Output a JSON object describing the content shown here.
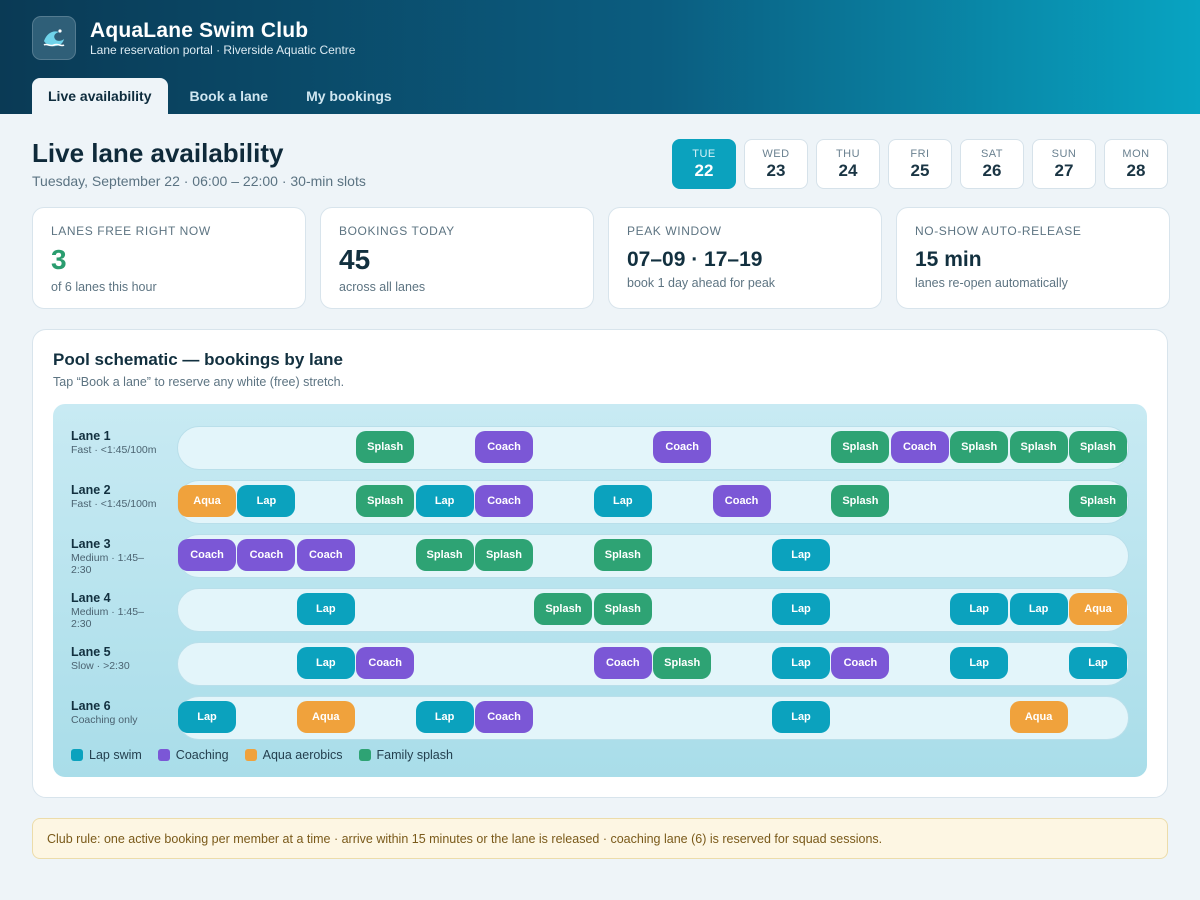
{
  "app": {
    "title": "AquaLane Swim Club",
    "subtitle": "Lane reservation portal · Riverside Aquatic Centre",
    "logo_icon": "wave-icon"
  },
  "tabs": [
    {
      "label": "Live availability",
      "active": true
    },
    {
      "label": "Book a lane",
      "active": false
    },
    {
      "label": "My bookings",
      "active": false
    }
  ],
  "page": {
    "title": "Live lane availability",
    "subtitle": "Tuesday, September 22 · 06:00 – 22:00 · 30-min slots"
  },
  "days": [
    {
      "weekday": "TUE",
      "date": "22",
      "selected": true
    },
    {
      "weekday": "WED",
      "date": "23",
      "selected": false
    },
    {
      "weekday": "THU",
      "date": "24",
      "selected": false
    },
    {
      "weekday": "FRI",
      "date": "25",
      "selected": false
    },
    {
      "weekday": "SAT",
      "date": "26",
      "selected": false
    },
    {
      "weekday": "SUN",
      "date": "27",
      "selected": false
    },
    {
      "weekday": "MON",
      "date": "28",
      "selected": false
    }
  ],
  "stats": [
    {
      "label": "LANES FREE RIGHT NOW",
      "value": "3",
      "hint": "of 6 lanes this hour",
      "accent": "#2a9d6f"
    },
    {
      "label": "BOOKINGS TODAY",
      "value": "45",
      "hint": "across all lanes"
    },
    {
      "label": "PEAK WINDOW",
      "value": "07–09 · 17–19",
      "hint": "book 1 day ahead for peak"
    },
    {
      "label": "NO-SHOW AUTO-RELEASE",
      "value": "15 min",
      "hint": "lanes re-open automatically"
    }
  ],
  "pool": {
    "title": "Pool schematic — bookings by lane",
    "subtitle": "Tap “Book a lane” to reserve any white (free) stretch.",
    "labels": {
      "lap": "Lap",
      "coach": "Coach",
      "aqua": "Aqua",
      "splash": "Splash"
    },
    "lanes": [
      {
        "name": "Lane 1",
        "desc": "Fast · <1:45/100m",
        "bookings": [
          {
            "slot": 3,
            "type": "splash"
          },
          {
            "slot": 5,
            "type": "coach"
          },
          {
            "slot": 8,
            "type": "coach"
          },
          {
            "slot": 11,
            "type": "splash"
          },
          {
            "slot": 12,
            "type": "coach"
          },
          {
            "slot": 13,
            "type": "splash"
          },
          {
            "slot": 14,
            "type": "splash"
          },
          {
            "slot": 15,
            "type": "splash"
          }
        ]
      },
      {
        "name": "Lane 2",
        "desc": "Fast · <1:45/100m",
        "bookings": [
          {
            "slot": 0,
            "type": "aqua"
          },
          {
            "slot": 1,
            "type": "lap"
          },
          {
            "slot": 3,
            "type": "splash"
          },
          {
            "slot": 4,
            "type": "lap"
          },
          {
            "slot": 5,
            "type": "coach"
          },
          {
            "slot": 7,
            "type": "lap"
          },
          {
            "slot": 9,
            "type": "coach"
          },
          {
            "slot": 11,
            "type": "splash"
          },
          {
            "slot": 15,
            "type": "splash"
          }
        ]
      },
      {
        "name": "Lane 3",
        "desc": "Medium · 1:45–2:30",
        "bookings": [
          {
            "slot": 0,
            "type": "coach"
          },
          {
            "slot": 1,
            "type": "coach"
          },
          {
            "slot": 2,
            "type": "coach"
          },
          {
            "slot": 4,
            "type": "splash"
          },
          {
            "slot": 5,
            "type": "splash"
          },
          {
            "slot": 7,
            "type": "splash"
          },
          {
            "slot": 10,
            "type": "lap"
          }
        ]
      },
      {
        "name": "Lane 4",
        "desc": "Medium · 1:45–2:30",
        "bookings": [
          {
            "slot": 2,
            "type": "lap"
          },
          {
            "slot": 6,
            "type": "splash"
          },
          {
            "slot": 7,
            "type": "splash"
          },
          {
            "slot": 10,
            "type": "lap"
          },
          {
            "slot": 13,
            "type": "lap"
          },
          {
            "slot": 14,
            "type": "lap"
          },
          {
            "slot": 15,
            "type": "aqua"
          }
        ]
      },
      {
        "name": "Lane 5",
        "desc": "Slow · >2:30",
        "bookings": [
          {
            "slot": 2,
            "type": "lap"
          },
          {
            "slot": 3,
            "type": "coach"
          },
          {
            "slot": 7,
            "type": "coach"
          },
          {
            "slot": 8,
            "type": "splash"
          },
          {
            "slot": 10,
            "type": "lap"
          },
          {
            "slot": 11,
            "type": "coach"
          },
          {
            "slot": 13,
            "type": "lap"
          },
          {
            "slot": 15,
            "type": "lap"
          }
        ]
      },
      {
        "name": "Lane 6",
        "desc": "Coaching only",
        "bookings": [
          {
            "slot": 0,
            "type": "lap"
          },
          {
            "slot": 2,
            "type": "aqua"
          },
          {
            "slot": 4,
            "type": "lap"
          },
          {
            "slot": 5,
            "type": "coach"
          },
          {
            "slot": 10,
            "type": "lap"
          },
          {
            "slot": 14,
            "type": "aqua"
          }
        ]
      }
    ],
    "legend": [
      {
        "label": "Lap swim",
        "type": "lap",
        "color": "#0ba2be"
      },
      {
        "label": "Coaching",
        "type": "coach",
        "color": "#7b57d6"
      },
      {
        "label": "Aqua aerobics",
        "type": "aqua",
        "color": "#f0a23c"
      },
      {
        "label": "Family splash",
        "type": "splash",
        "color": "#2ea374"
      }
    ]
  },
  "notice": "Club rule: one active booking per member at a time · arrive within 15 minutes or the lane is released · coaching lane (6) is reserved for squad sessions."
}
